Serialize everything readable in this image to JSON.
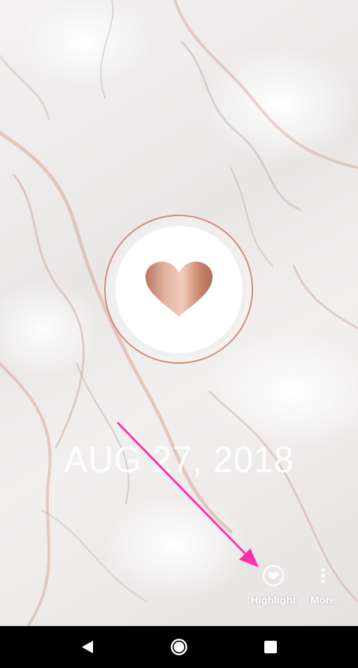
{
  "story": {
    "date_text": "AUG 27, 2018",
    "accent_color": "#c98d76",
    "arrow_color": "#ff2fa8"
  },
  "actions": {
    "highlight": {
      "label": "Highlight",
      "icon": "heart-circle-icon"
    },
    "more": {
      "label": "More",
      "icon": "more-vertical-icon"
    }
  },
  "navbar": {
    "back": "back-triangle-icon",
    "home": "home-circle-icon",
    "recents": "recents-square-icon"
  }
}
